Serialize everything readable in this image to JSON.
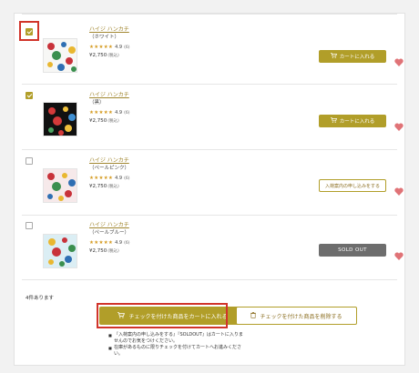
{
  "items": [
    {
      "name": "ハイジ ハンカチ",
      "variant": "（ホワイト）",
      "stars": "★★★★★",
      "rating": "4.9",
      "review_count": "(6)",
      "price": "¥2,750",
      "tax_note": "(税込)",
      "checked": true,
      "action_label": "カートに入れる",
      "action_type": "cart"
    },
    {
      "name": "ハイジ ハンカチ",
      "variant": "（黒）",
      "stars": "★★★★★",
      "rating": "4.9",
      "review_count": "(6)",
      "price": "¥2,750",
      "tax_note": "(税込)",
      "checked": true,
      "action_label": "カートに入れる",
      "action_type": "cart"
    },
    {
      "name": "ハイジ ハンカチ",
      "variant": "（ペールピンク）",
      "stars": "★★★★★",
      "rating": "4.9",
      "review_count": "(6)",
      "price": "¥2,750",
      "tax_note": "(税込)",
      "checked": false,
      "action_label": "入荷案内の申し込みをする",
      "action_type": "restock"
    },
    {
      "name": "ハイジ ハンカチ",
      "variant": "（ペールブルー）",
      "stars": "★★★★★",
      "rating": "4.9",
      "review_count": "(6)",
      "price": "¥2,750",
      "tax_note": "(税込)",
      "checked": false,
      "action_label": "SOLD OUT",
      "action_type": "soldout"
    }
  ],
  "footer": {
    "count_text": "4件あります",
    "bulk_add_label": "チェックを付けた商品をカートに入れる",
    "bulk_delete_label": "チェックを付けた商品を削除する",
    "notes": [
      "『入荷案内の申し込みをする』『SOLDOUT』はカートに入りませんのでお気をつけください。",
      "在庫があるものに限りチェックを付けてカートへお進みください。"
    ]
  },
  "colors": {
    "accent": "#b19e29",
    "heart": "#e07377",
    "highlight": "#d1342a",
    "soldout": "#6d6d6d"
  },
  "icons": [
    "checkbox-checked-icon",
    "cart-icon",
    "heart-icon",
    "trash-icon"
  ]
}
